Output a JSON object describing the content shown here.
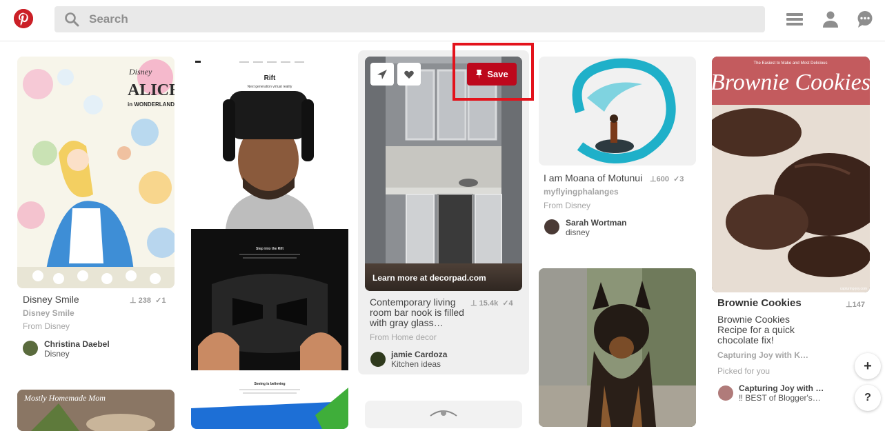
{
  "search": {
    "placeholder": "Search"
  },
  "pins": [
    {
      "title": "Disney Smile",
      "saves": "238",
      "repins": "1",
      "source": "Disney Smile",
      "from": "From Disney",
      "user": "Christina Daebel",
      "board": "Disney"
    },
    {
      "title": "Contemporary living room bar nook is filled with gray glass…",
      "saves": "15.4k",
      "repins": "4",
      "overlay": "Learn more at decorpad.com",
      "from": "From Home decor",
      "user": "jamie Cardoza",
      "board": "Kitchen ideas",
      "save_label": "Save"
    },
    {
      "title": "I am Moana of Motunui",
      "saves": "600",
      "repins": "3",
      "source": "myflyingphalanges",
      "from": "From Disney",
      "user": "Sarah Wortman",
      "board": "disney"
    },
    {
      "title": "Brownie Cookies",
      "saves": "147",
      "description": "Brownie Cookies Recipe for a quick chocolate fix!",
      "source": "Capturing Joy with K…",
      "from": "Picked for you",
      "user": "Capturing Joy with …",
      "board": "‼ BEST of Blogger's…"
    }
  ],
  "images": {
    "alice": {
      "brand": "Disney",
      "title": "ALICE",
      "subtitle": "in WONDERLAND"
    },
    "rift": {
      "title": "Rift",
      "subtitle": "Next generation virtual reality",
      "section": "Step into the Rift",
      "section2": "Seeing is believing"
    },
    "brownie": {
      "header": "The Easiest to Make and Most Delicious",
      "title": "Brownie Cookies",
      "watermark": "capturing-joy.com"
    },
    "mostly": {
      "text": "Mostly Homemade Mom"
    }
  },
  "fabs": {
    "add": "+",
    "help": "?"
  },
  "colors": {
    "brand": "#bd081c",
    "highlight": "#e3121b"
  }
}
